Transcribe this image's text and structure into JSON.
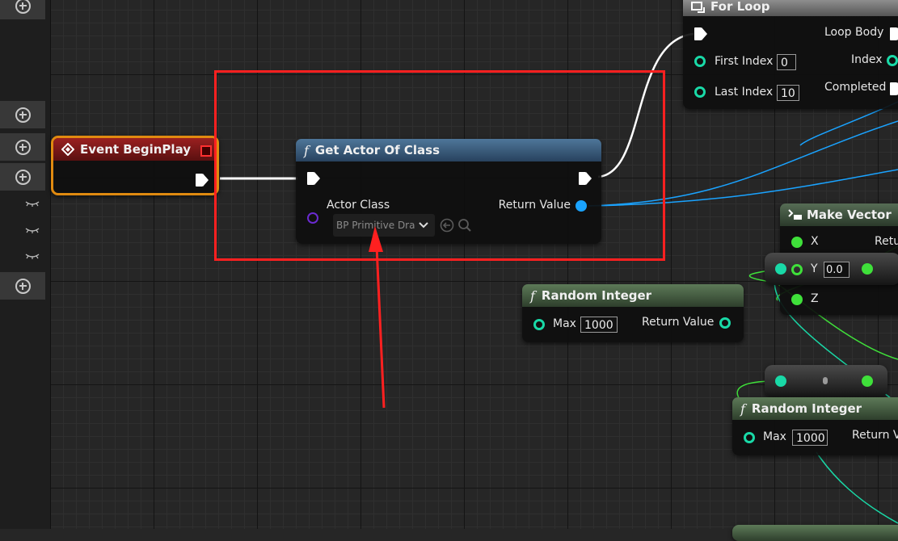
{
  "nodes": {
    "event_begin_play": {
      "title": "Event BeginPlay"
    },
    "get_actor_of_class": {
      "title": "Get Actor Of Class",
      "fn_symbol": "f",
      "actor_class_label": "Actor Class",
      "actor_class_value": "BP Primitive Draw",
      "return_value_label": "Return Value"
    },
    "for_loop": {
      "title": "For Loop",
      "loop_body_label": "Loop Body",
      "first_index_label": "First Index",
      "first_index_value": "0",
      "index_label": "Index",
      "last_index_label": "Last Index",
      "last_index_value": "10",
      "completed_label": "Completed"
    },
    "make_vector": {
      "title": "Make Vector",
      "x_label": "X",
      "y_label": "Y",
      "y_value": "0.0",
      "z_label": "Z",
      "return_label": "Retu"
    },
    "random_integer_1": {
      "title": "Random Integer",
      "fn_symbol": "f",
      "max_label": "Max",
      "max_value": "1000",
      "return_value_label": "Return Value"
    },
    "random_integer_2": {
      "title": "Random Integer",
      "fn_symbol": "f",
      "max_label": "Max",
      "max_value": "1000",
      "return_value_label": "Return V"
    }
  },
  "colors": {
    "event_header": "#8a1c1c",
    "function_header": "#3d5f80",
    "pure_function_header": "#4f6b4a",
    "exec_wire": "#ffffff",
    "object_wire": "#1aa3ff",
    "float_wire": "#3fe03a",
    "int_wire": "#19d9a7",
    "annotation": "#ff2020"
  }
}
